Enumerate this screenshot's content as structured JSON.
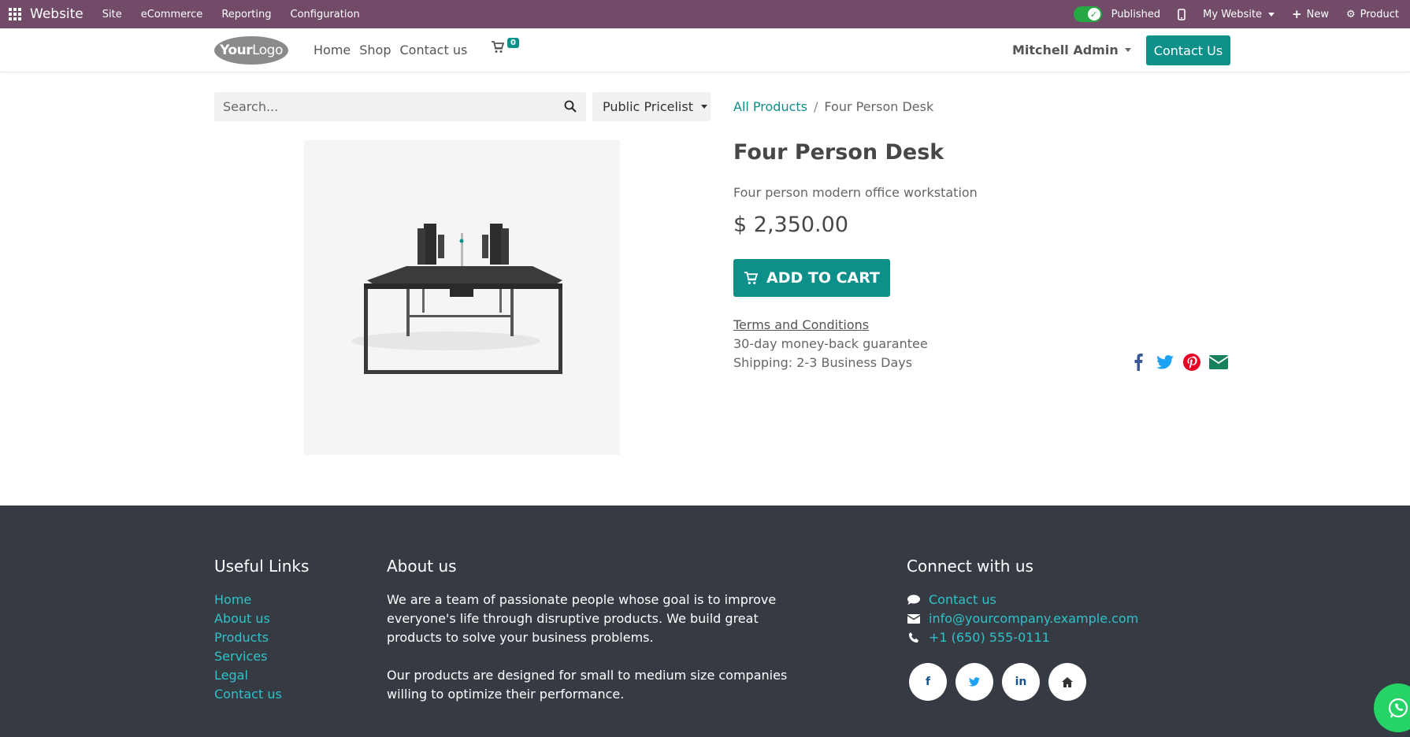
{
  "topbar": {
    "brand": "Website",
    "menus": [
      "Site",
      "eCommerce",
      "Reporting",
      "Configuration"
    ],
    "published": "Published",
    "my_website": "My Website",
    "new": "New",
    "product": "Product"
  },
  "header": {
    "logo_your": "Your",
    "logo_logo": "Logo",
    "nav": [
      "Home",
      "Shop",
      "Contact us"
    ],
    "cart_count": "0",
    "user": "Mitchell Admin",
    "contact_button": "Contact Us"
  },
  "search": {
    "placeholder": "Search..."
  },
  "pricelist": "Public Pricelist",
  "breadcrumb": {
    "parent": "All Products",
    "current": "Four Person Desk"
  },
  "product": {
    "title": "Four Person Desk",
    "description": "Four person modern office workstation",
    "price": "$ 2,350.00",
    "add_to_cart": "ADD TO CART",
    "terms": "Terms and Conditions",
    "guarantee": "30-day money-back guarantee",
    "shipping": "Shipping: 2-3 Business Days"
  },
  "footer": {
    "useful_links": {
      "title": "Useful Links",
      "links": [
        "Home",
        "About us",
        "Products",
        "Services",
        "Legal",
        "Contact us"
      ]
    },
    "about": {
      "title": "About us",
      "p1": "We are a team of passionate people whose goal is to improve everyone's life through disruptive products. We build great products to solve your business problems.",
      "p2": "Our products are designed for small to medium size companies willing to optimize their performance."
    },
    "connect": {
      "title": "Connect with us",
      "contact": "Contact us",
      "email": "info@yourcompany.example.com",
      "phone": "+1 (650) 555-0111",
      "social_facebook": "f",
      "social_linkedin": "in"
    }
  },
  "colors": {
    "admin_bar": "#714b67",
    "accent": "#0d8f8a",
    "footer_bg": "#363b43",
    "footer_link": "#2fc2c9"
  }
}
